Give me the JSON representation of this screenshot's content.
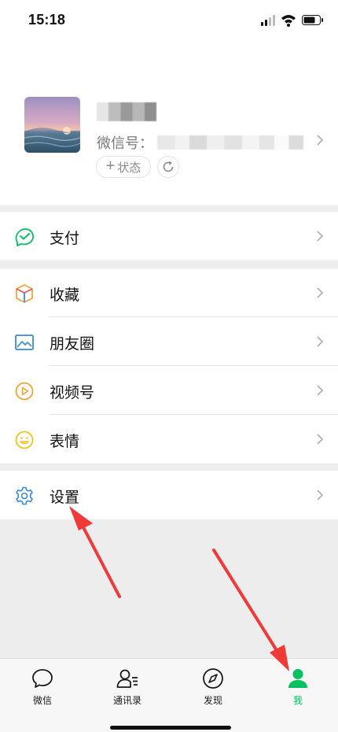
{
  "status_bar": {
    "time": "15:18",
    "icons": [
      "signal-icon",
      "wifi-icon",
      "battery-icon"
    ]
  },
  "profile": {
    "nickname": "",
    "wechat_id_label": "微信号：",
    "wechat_id": "",
    "status_button": "状态",
    "status_button_icon": "plus-icon",
    "refresh_icon": "refresh-icon"
  },
  "menu_groups": [
    [
      {
        "label": "支付",
        "icon": "pay-icon",
        "color": "#07c160"
      }
    ],
    [
      {
        "label": "收藏",
        "icon": "favorites-cube-icon",
        "color": "#e8a93b"
      },
      {
        "label": "朋友圈",
        "icon": "moments-image-icon",
        "color": "#3d88d6"
      },
      {
        "label": "视频号",
        "icon": "channels-play-icon",
        "color": "#f0a437"
      },
      {
        "label": "表情",
        "icon": "emoji-face-icon",
        "color": "#f2c322"
      }
    ],
    [
      {
        "label": "设置",
        "icon": "settings-gear-icon",
        "color": "#3d88d6"
      }
    ]
  ],
  "tab_bar": {
    "tabs": [
      {
        "label": "微信",
        "icon": "chat-bubble-icon",
        "active": false
      },
      {
        "label": "通讯录",
        "icon": "contacts-icon",
        "active": false
      },
      {
        "label": "发现",
        "icon": "compass-icon",
        "active": false
      },
      {
        "label": "我",
        "icon": "person-icon",
        "active": true
      }
    ],
    "active_color": "#07c160"
  },
  "annotations": {
    "arrow_color": "#f03a3a"
  }
}
